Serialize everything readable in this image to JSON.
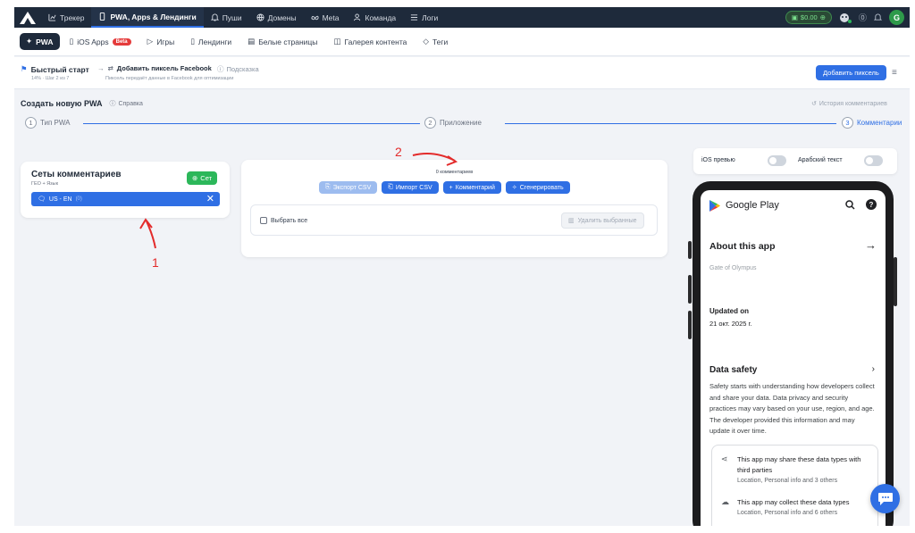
{
  "topnav": {
    "items": [
      {
        "label": "Трекер",
        "icon": "chart-icon"
      },
      {
        "label": "PWA, Apps & Лендинги",
        "icon": "phone-icon",
        "active": true
      },
      {
        "label": "Пуши",
        "icon": "bell-icon"
      },
      {
        "label": "Домены",
        "icon": "globe-icon"
      },
      {
        "label": "Meta",
        "icon": "meta-icon"
      },
      {
        "label": "Команда",
        "icon": "team-icon"
      },
      {
        "label": "Логи",
        "icon": "list-icon"
      }
    ],
    "balance": "$0.00",
    "avatar_letter": "G"
  },
  "subnav": {
    "items": [
      {
        "label": "PWA",
        "active": true
      },
      {
        "label": "iOS Apps",
        "badge": "Beta"
      },
      {
        "label": "Игры"
      },
      {
        "label": "Лендинги"
      },
      {
        "label": "Белые страницы"
      },
      {
        "label": "Галерея контента"
      },
      {
        "label": "Теги"
      }
    ]
  },
  "quickstart": {
    "title": "Быстрый старт",
    "progress": "14% · Шаг 2 из 7",
    "step_title": "Добавить пиксель Facebook",
    "hint": "Подсказка",
    "step_desc": "Пиксель передаёт данные в Facebook для оптимизации",
    "add_pixel_button": "Добавить пиксель"
  },
  "page": {
    "title": "Создать новую PWA",
    "help": "Справка",
    "history": "История комментариев"
  },
  "stepper": {
    "steps": [
      {
        "num": "1",
        "label": "Тип PWA"
      },
      {
        "num": "2",
        "label": "Приложение"
      },
      {
        "num": "3",
        "label": "Комментарии"
      }
    ]
  },
  "sets": {
    "title": "Сеты комментариев",
    "subtitle": "ГЕО + Язык",
    "add_button": "Сет",
    "item_label": "US - EN",
    "item_count": "(0)"
  },
  "comments": {
    "count_label": "0 комментариев",
    "export_button": "Экспорт CSV",
    "import_button": "Импорт CSV",
    "add_button": "Комментарий",
    "generate_button": "Сгенерировать",
    "select_all": "Выбрать все",
    "delete_selected": "Удалить выбранные"
  },
  "preview": {
    "ios_label": "iOS превью",
    "arabic_label": "Арабский текст",
    "store_name": "Google Play",
    "about_title": "About this app",
    "app_name": "Gate of Olympus",
    "updated_label": "Updated on",
    "updated_value": "21 окт. 2025 г.",
    "data_safety_title": "Data safety",
    "data_safety_text": "Safety starts with understanding how developers collect and share your data. Data privacy and security practices may vary based on your use, region, and age. The developer provided this information and may update it over time.",
    "share_title": "This app may share these data types with third parties",
    "share_sub": "Location, Personal info and 3 others",
    "collect_title": "This app may collect these data types",
    "collect_sub": "Location, Personal info and 6 others"
  },
  "annotations": {
    "label_1": "1",
    "label_2": "2",
    "color": "#e32b2b"
  },
  "colors": {
    "primary": "#2f6fe4",
    "nav_bg": "#1e2a3b",
    "success": "#2cb75a"
  }
}
